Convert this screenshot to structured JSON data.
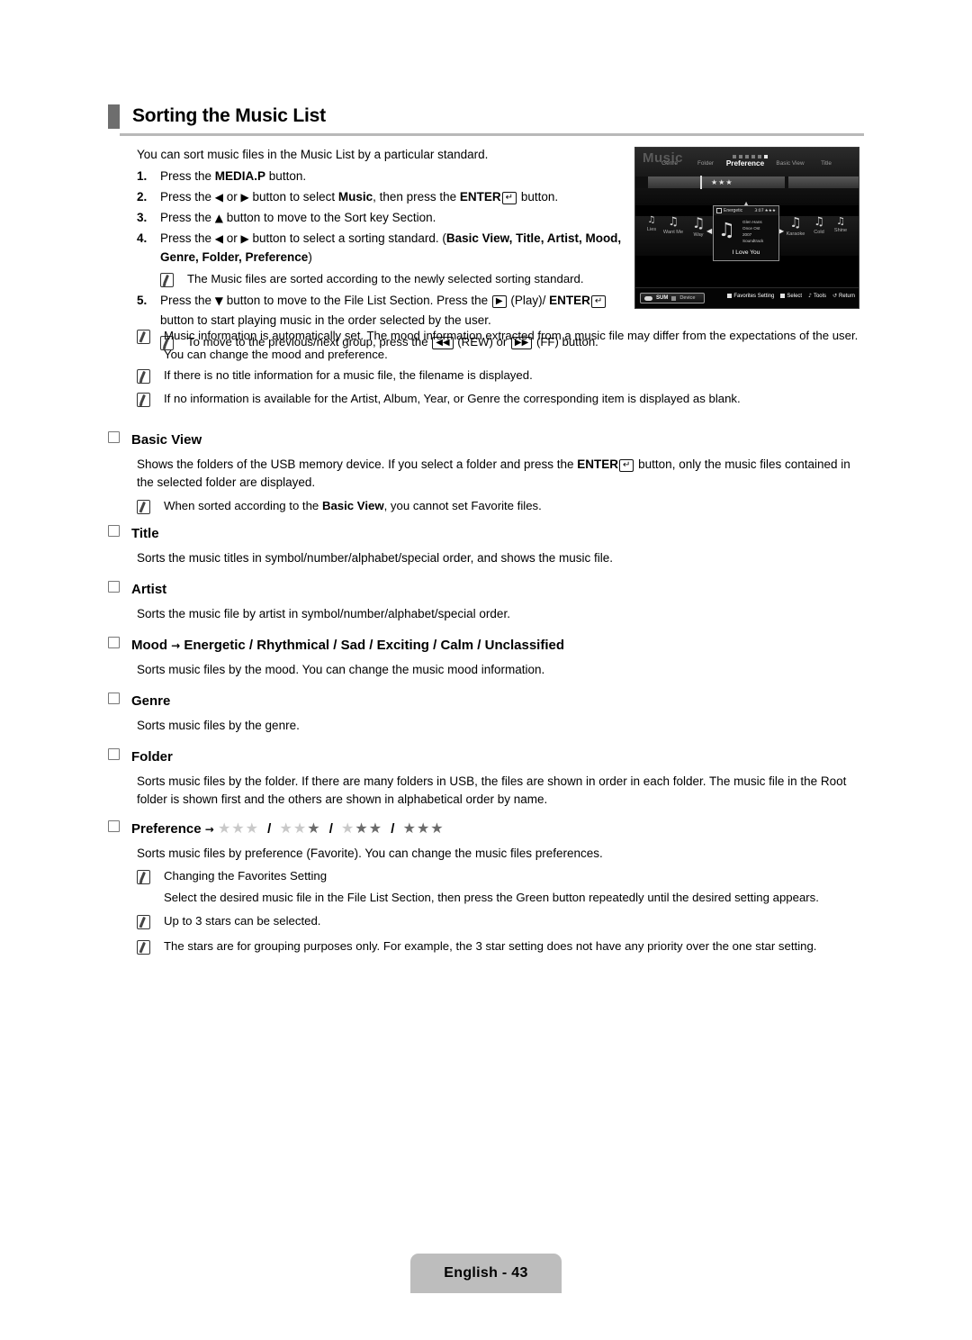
{
  "page": {
    "title": "Sorting the Music List",
    "intro": "You can sort music files in the Music List by a particular standard.",
    "footer_label": "English - 43"
  },
  "steps": [
    {
      "num": "1.",
      "parts": [
        {
          "t": "Press the ",
          "style": "normal"
        },
        {
          "t": "MEDIA.P",
          "style": "bold"
        },
        {
          "t": " button.",
          "style": "normal"
        }
      ]
    },
    {
      "num": "2.",
      "parts": [
        {
          "t": "Press the ",
          "style": "normal"
        },
        {
          "t": "◀",
          "style": "glyph"
        },
        {
          "t": " or ",
          "style": "normal"
        },
        {
          "t": "▶",
          "style": "glyph"
        },
        {
          "t": " button to select ",
          "style": "normal"
        },
        {
          "t": "Music",
          "style": "bold"
        },
        {
          "t": ", then press the ",
          "style": "normal"
        },
        {
          "t": "ENTER",
          "style": "bold"
        },
        {
          "t": "↵",
          "style": "keybox"
        },
        {
          "t": " button.",
          "style": "normal"
        }
      ]
    },
    {
      "num": "3.",
      "parts": [
        {
          "t": "Press the ",
          "style": "normal"
        },
        {
          "t": "▲",
          "style": "glyph"
        },
        {
          "t": " button to move to the Sort key Section.",
          "style": "normal"
        }
      ]
    },
    {
      "num": "4.",
      "parts": [
        {
          "t": "Press the ",
          "style": "normal"
        },
        {
          "t": "◀",
          "style": "glyph"
        },
        {
          "t": " or ",
          "style": "normal"
        },
        {
          "t": "▶",
          "style": "glyph"
        },
        {
          "t": " button to select a sorting standard. (",
          "style": "normal"
        },
        {
          "t": "Basic View, Title, Artist, Mood, Genre, Folder, Preference",
          "style": "bold"
        },
        {
          "t": ")",
          "style": "normal"
        }
      ],
      "notes": [
        {
          "parts": [
            {
              "t": "The Music files are sorted according to the newly selected sorting standard.",
              "style": "normal"
            }
          ]
        }
      ]
    },
    {
      "num": "5.",
      "parts": [
        {
          "t": "Press the ",
          "style": "normal"
        },
        {
          "t": "▼",
          "style": "glyph"
        },
        {
          "t": " button to move to the File List Section. Press the ",
          "style": "normal"
        },
        {
          "t": "▶",
          "style": "keybox"
        },
        {
          "t": " (Play)/ ",
          "style": "normal"
        },
        {
          "t": "ENTER",
          "style": "bold"
        },
        {
          "t": "↵",
          "style": "keybox"
        },
        {
          "t": " button to start playing music in the order selected by the user.",
          "style": "normal"
        }
      ],
      "notes": [
        {
          "parts": [
            {
              "t": "To move to the previous/next group, press the ",
              "style": "normal"
            },
            {
              "t": "◀◀",
              "style": "keybox"
            },
            {
              "t": " (REW) or ",
              "style": "normal"
            },
            {
              "t": "▶▶",
              "style": "keybox"
            },
            {
              "t": " (FF) button.",
              "style": "normal"
            }
          ]
        }
      ]
    }
  ],
  "wide_notes": [
    {
      "parts": [
        {
          "t": "Music information is automatically set. The mood information extracted from a music file may differ from the expectations of the user. You can change the mood and preference.",
          "style": "normal"
        }
      ]
    },
    {
      "parts": [
        {
          "t": "If there is no title information for a music file, the filename is displayed.",
          "style": "normal"
        }
      ]
    },
    {
      "parts": [
        {
          "t": "If no information is available for the Artist, Album, Year, or Genre the corresponding item is displayed as blank.",
          "style": "normal"
        }
      ]
    }
  ],
  "sections": [
    {
      "heading_parts": [
        {
          "t": "Basic View",
          "style": "bold"
        }
      ],
      "body_parts": [
        {
          "t": "Shows the folders of the USB memory device. If you select a folder and press the ",
          "style": "normal"
        },
        {
          "t": "ENTER",
          "style": "bold"
        },
        {
          "t": "↵",
          "style": "keybox"
        },
        {
          "t": " button, only the music files contained in the selected folder are displayed.",
          "style": "normal"
        }
      ],
      "notes": [
        {
          "parts": [
            {
              "t": "When sorted according to the ",
              "style": "normal"
            },
            {
              "t": "Basic View",
              "style": "bold"
            },
            {
              "t": ", you cannot set Favorite files.",
              "style": "normal"
            }
          ]
        }
      ]
    },
    {
      "heading_parts": [
        {
          "t": "Title",
          "style": "bold"
        }
      ],
      "body_parts": [
        {
          "t": "Sorts the music titles in symbol/number/alphabet/special order, and shows the music file.",
          "style": "normal"
        }
      ],
      "notes": []
    },
    {
      "heading_parts": [
        {
          "t": "Artist",
          "style": "bold"
        }
      ],
      "body_parts": [
        {
          "t": "Sorts the music file by artist in symbol/number/alphabet/special order.",
          "style": "normal"
        }
      ],
      "notes": []
    },
    {
      "heading_parts": [
        {
          "t": "Mood ",
          "style": "bold"
        },
        {
          "t": "→",
          "style": "glyph-bold"
        },
        {
          "t": " Energetic / Rhythmical / Sad / Exciting / Calm / Unclassified",
          "style": "bold"
        }
      ],
      "body_parts": [
        {
          "t": "Sorts music files by the mood. You can change the music mood information.",
          "style": "normal"
        }
      ],
      "notes": []
    },
    {
      "heading_parts": [
        {
          "t": "Genre",
          "style": "bold"
        }
      ],
      "body_parts": [
        {
          "t": "Sorts music files by the genre.",
          "style": "normal"
        }
      ],
      "notes": []
    },
    {
      "heading_parts": [
        {
          "t": "Folder",
          "style": "bold"
        }
      ],
      "body_parts": [
        {
          "t": "Sorts music files by the folder. If there are many folders in USB, the files are shown in order in each folder. The music file in the Root folder is shown first and the others are shown in alphabetical order by name.",
          "style": "normal"
        }
      ],
      "notes": []
    },
    {
      "heading_parts": [
        {
          "t": "Preference ",
          "style": "bold"
        },
        {
          "t": "→",
          "style": "glyph-bold"
        },
        {
          "t": " ",
          "style": "normal"
        },
        {
          "t": "stars:0",
          "style": "stars"
        },
        {
          "t": " / ",
          "style": "slash"
        },
        {
          "t": "stars:1",
          "style": "stars"
        },
        {
          "t": " / ",
          "style": "slash"
        },
        {
          "t": "stars:2",
          "style": "stars"
        },
        {
          "t": " / ",
          "style": "slash"
        },
        {
          "t": "stars:3",
          "style": "stars"
        }
      ],
      "body_parts": [
        {
          "t": "Sorts music files by preference (Favorite). You can change the music files preferences.",
          "style": "normal"
        }
      ],
      "notes": [
        {
          "parts": [
            {
              "t": "Changing the Favorites Setting",
              "style": "normal"
            }
          ],
          "sub": "Select the desired music file in the File List Section, then press the Green button repeatedly until the desired setting appears."
        },
        {
          "parts": [
            {
              "t": "Up to 3 stars can be selected.",
              "style": "normal"
            }
          ]
        },
        {
          "parts": [
            {
              "t": "The stars are for grouping purposes only. For example, the 3 star setting does not have any priority over the one star setting.",
              "style": "normal"
            }
          ]
        }
      ]
    }
  ],
  "tv": {
    "screen_word": "Music",
    "nav_items": [
      {
        "label": "Genre",
        "selected": false
      },
      {
        "label": "Folder",
        "selected": false
      },
      {
        "label": "Preference",
        "selected": true
      },
      {
        "label": "Basic View",
        "selected": false
      },
      {
        "label": "Title",
        "selected": false
      }
    ],
    "progress_stars": "★★★",
    "items": [
      {
        "label": "Lies"
      },
      {
        "label": "Want Me"
      },
      {
        "label": "Way"
      },
      {
        "label": "Karaoke"
      },
      {
        "label": "Cold"
      },
      {
        "label": "Shine"
      }
    ],
    "panel": {
      "mood": "Energetic",
      "duration": "3:07",
      "stars": "★★★",
      "meta_lines": [
        "Glen Hans",
        "Once Ost",
        "2007",
        "Soundtrack"
      ],
      "title": "I Love You"
    },
    "footer": {
      "source_label": "SUM",
      "device_label": "Device",
      "keys": [
        {
          "label": "Favorites Setting",
          "glyph": ""
        },
        {
          "label": "Select",
          "glyph": ""
        },
        {
          "label": "Tools",
          "glyph": "♪"
        },
        {
          "label": "Return",
          "glyph": "↺"
        }
      ]
    }
  }
}
